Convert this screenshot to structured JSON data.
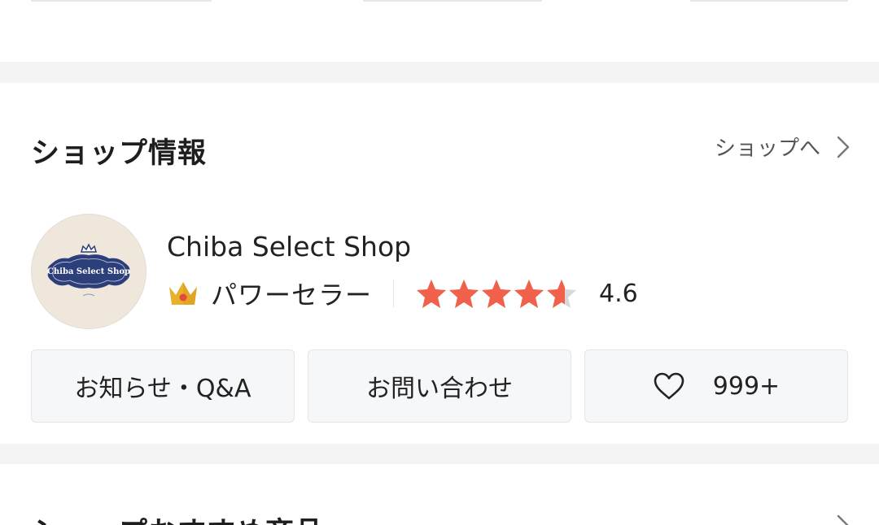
{
  "section": {
    "title": "ショップ情報",
    "link_label": "ショップへ"
  },
  "shop": {
    "name": "Chiba Select Shop",
    "logo_text": "Chiba Select Shop",
    "badge_label": "パワーセラー",
    "rating_value": "4.6",
    "rating_number": 4.6,
    "rating_max": 5
  },
  "buttons": {
    "notice_qa": "お知らせ・Q&A",
    "contact": "お問い合わせ",
    "favorite_count": "999+"
  },
  "next_section": {
    "title": "ショップおすすめ商品"
  },
  "colors": {
    "star": "#f0604b",
    "star_empty": "#d8d8d8",
    "crown": "#e8b02c",
    "logo_navy": "#2d3f7a",
    "button_bg": "#f6f7f9"
  },
  "icons": {
    "link_chevron": "chevron-right-icon",
    "crown": "crown-icon",
    "star": "star-icon",
    "heart": "heart-icon"
  }
}
